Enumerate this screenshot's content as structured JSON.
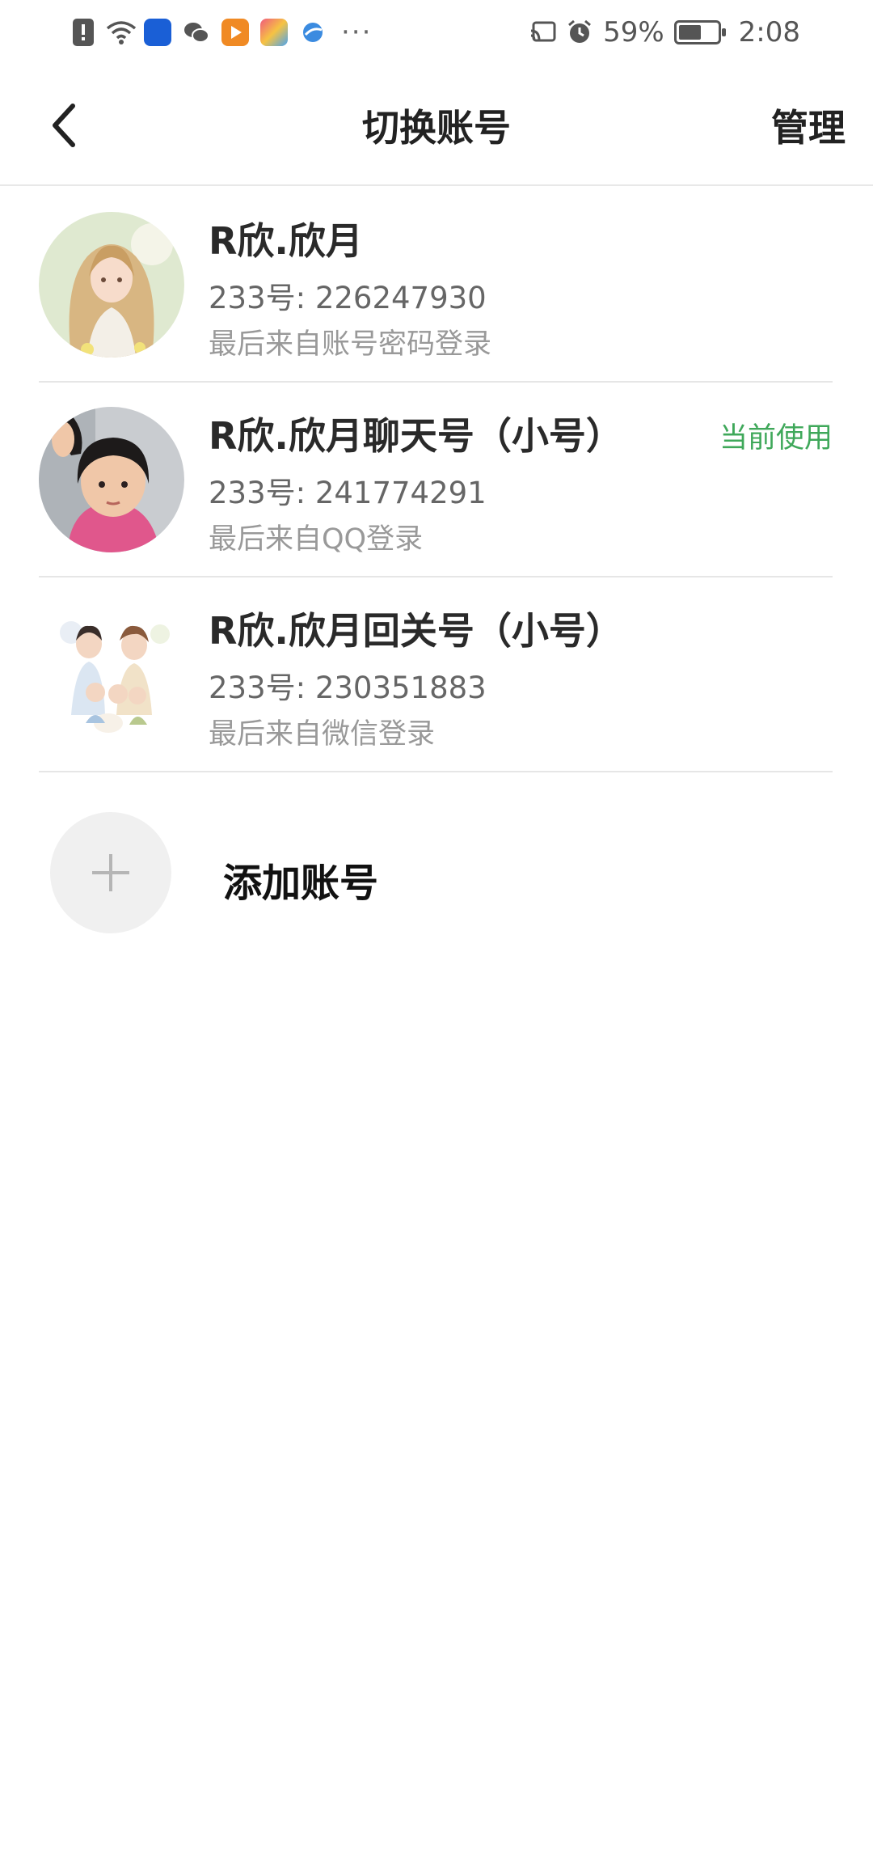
{
  "status_bar": {
    "battery_percent": "59%",
    "battery_level": 0.59,
    "time": "2:08",
    "overflow": "···",
    "left_icons": [
      "alert-icon",
      "wifi-icon",
      "video-app-icon",
      "wechat-icon",
      "player-app-icon",
      "colorful-app-icon",
      "browser-app-icon"
    ],
    "right_icons": [
      "cast-icon",
      "alarm-icon",
      "battery-icon"
    ]
  },
  "header": {
    "title": "切换账号",
    "manage_label": "管理",
    "back_icon": "chevron-left-icon"
  },
  "accounts": [
    {
      "name": "R欣.欣月",
      "id_text": "233号: 226247930",
      "login_text": "最后来自账号密码登录",
      "current": "",
      "avatar": "anime-girl-avatar"
    },
    {
      "name": "R欣.欣月聊天号（小号）",
      "id_text": "233号: 241774291",
      "login_text": "最后来自QQ登录",
      "current": "当前使用",
      "avatar": "child-photo-avatar"
    },
    {
      "name": "R欣.欣月回关号（小号）",
      "id_text": "233号: 230351883",
      "login_text": "最后来自微信登录",
      "current": "",
      "avatar": "family-illustration-avatar"
    }
  ],
  "add_account": {
    "label": "添加账号",
    "icon": "plus-icon"
  },
  "colors": {
    "current_green": "#3fa85a",
    "divider": "#e6e6e6"
  }
}
